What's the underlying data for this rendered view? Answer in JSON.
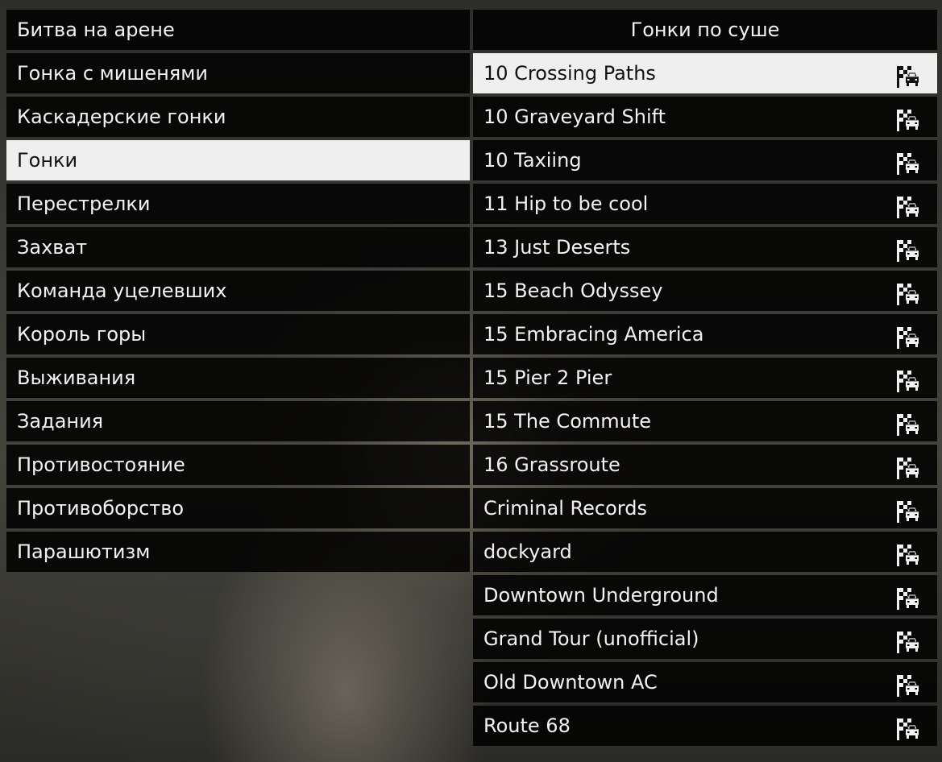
{
  "categories": {
    "items": [
      {
        "label": "Битва на арене",
        "selected": false
      },
      {
        "label": "Гонка с мишенями",
        "selected": false
      },
      {
        "label": "Каскадерские гонки",
        "selected": false
      },
      {
        "label": "Гонки",
        "selected": true
      },
      {
        "label": "Перестрелки",
        "selected": false
      },
      {
        "label": "Захват",
        "selected": false
      },
      {
        "label": "Команда уцелевших",
        "selected": false
      },
      {
        "label": "Король горы",
        "selected": false
      },
      {
        "label": "Выживания",
        "selected": false
      },
      {
        "label": "Задания",
        "selected": false
      },
      {
        "label": "Противостояние",
        "selected": false
      },
      {
        "label": "Противоборство",
        "selected": false
      },
      {
        "label": "Парашютизм",
        "selected": false
      }
    ]
  },
  "jobs": {
    "header": "Гонки по суше",
    "icon": "race-flag-car-icon",
    "items": [
      {
        "label": "10 Crossing Paths",
        "selected": true
      },
      {
        "label": "10 Graveyard Shift",
        "selected": false
      },
      {
        "label": "10 Taxiing",
        "selected": false
      },
      {
        "label": "11 Hip to be cool",
        "selected": false
      },
      {
        "label": "13 Just Deserts",
        "selected": false
      },
      {
        "label": "15 Beach Odyssey",
        "selected": false
      },
      {
        "label": "15 Embracing America",
        "selected": false
      },
      {
        "label": "15 Pier 2 Pier",
        "selected": false
      },
      {
        "label": "15 The Commute",
        "selected": false
      },
      {
        "label": "16 Grassroute",
        "selected": false
      },
      {
        "label": "Criminal Records",
        "selected": false
      },
      {
        "label": "dockyard",
        "selected": false
      },
      {
        "label": "Downtown Underground",
        "selected": false
      },
      {
        "label": "Grand Tour (unofficial)",
        "selected": false
      },
      {
        "label": "Old Downtown AC",
        "selected": false
      },
      {
        "label": "Route 68",
        "selected": false
      }
    ]
  },
  "colors": {
    "row_bg": "#000000",
    "selected_bg": "#efefef",
    "text": "#f2f2f2",
    "selected_text": "#111111"
  }
}
